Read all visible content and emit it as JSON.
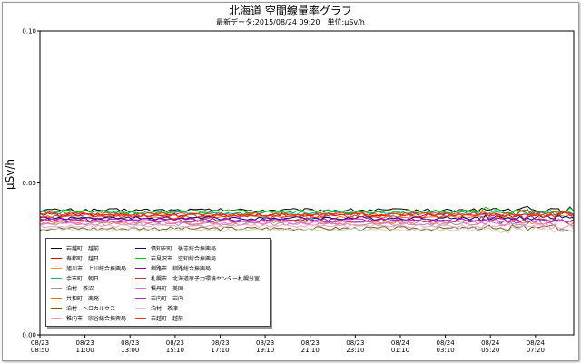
{
  "chart_data": {
    "type": "line",
    "title": "北海道 空間線量率グラフ",
    "subtitle": "最新データ:2015/08/24 09:20　単位:μSv/h",
    "ylabel": "μSv/h",
    "xlabel": "",
    "ylim": [
      0.0,
      0.1
    ],
    "yticks": [
      "0.00",
      "0.05",
      "0.10"
    ],
    "grid": false,
    "legend_position": "bottom-left",
    "x_ticks": [
      {
        "date": "08/23",
        "time": "08:50"
      },
      {
        "date": "08/23",
        "time": "11:00"
      },
      {
        "date": "08/23",
        "time": "13:00"
      },
      {
        "date": "08/23",
        "time": "15:10"
      },
      {
        "date": "08/23",
        "time": "17:10"
      },
      {
        "date": "08/23",
        "time": "19:10"
      },
      {
        "date": "08/23",
        "time": "21:10"
      },
      {
        "date": "08/23",
        "time": "23:10"
      },
      {
        "date": "08/24",
        "time": "01:10"
      },
      {
        "date": "08/24",
        "time": "03:10"
      },
      {
        "date": "08/24",
        "time": "05:20"
      },
      {
        "date": "08/24",
        "time": "07:20"
      }
    ],
    "series": [
      {
        "name": "岩越町　越前",
        "color": "#000000",
        "level": 0.041
      },
      {
        "name": "寿都町　越日",
        "color": "#cc0000",
        "level": 0.0395
      },
      {
        "name": "旭川市　上川総合振興局",
        "color": "#ff9900",
        "level": 0.0372
      },
      {
        "name": "余市町　朝日",
        "color": "#00aaaa",
        "level": 0.0402
      },
      {
        "name": "泊村　茶沼",
        "color": "#999999",
        "level": 0.0365
      },
      {
        "name": "共和町　南発",
        "color": "#ff6600",
        "level": 0.0388
      },
      {
        "name": "泊村　ヘロカルウス",
        "color": "#666600",
        "level": 0.035
      },
      {
        "name": "稚内市　宗谷総合振興局",
        "color": "#ff99cc",
        "level": 0.0358
      },
      {
        "name": "倶知安町　後志総合振興局",
        "color": "#000099",
        "level": 0.0384
      },
      {
        "name": "岩見沢市　空知総合振興局",
        "color": "#00cc00",
        "level": 0.0406
      },
      {
        "name": "釧路市　釧路総合振興局",
        "color": "#990099",
        "level": 0.0378
      },
      {
        "name": "札幌市　北海道原子力環境センター札幌分室",
        "color": "#cc3333",
        "level": 0.0392
      },
      {
        "name": "積丹町　美国",
        "color": "#ff66cc",
        "level": 0.0369
      },
      {
        "name": "岩内町　岩内",
        "color": "#9933cc",
        "level": 0.0376
      },
      {
        "name": "泊村　茶津",
        "color": "#cccccc",
        "level": 0.0345
      },
      {
        "name": "岩越町　越前",
        "color": "#ff3300",
        "level": 0.0398
      }
    ]
  }
}
